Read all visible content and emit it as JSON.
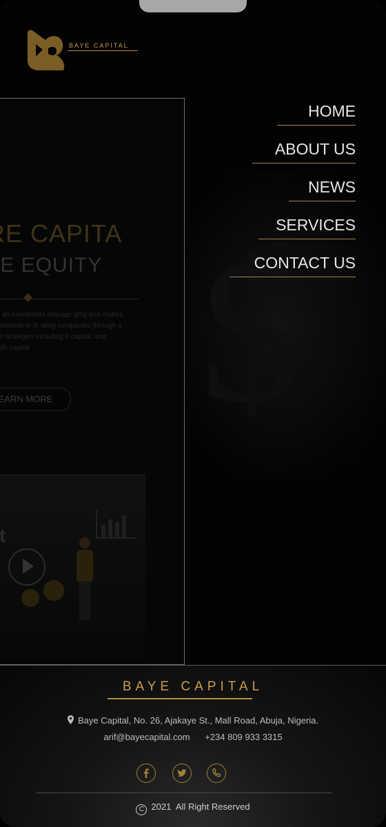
{
  "brand": {
    "logo_text": "BAYE CAPITAL",
    "accent_color": "#c49a4a"
  },
  "nav": {
    "items": [
      {
        "label": "HOME"
      },
      {
        "label": "ABOUT US"
      },
      {
        "label": "NEWS"
      },
      {
        "label": "SERVICES"
      },
      {
        "label": "CONTACT US"
      }
    ]
  },
  "preview": {
    "title_line1": "RE CAPITA",
    "title_line2": "TE EQUITY",
    "body": "firm, an investment manage ging and makes investments in th ating companies through a ment strategies including e capital, and growth capital",
    "button_label": "EARN MORE",
    "video_letter": "t",
    "play_icon": "play-icon"
  },
  "footer": {
    "brand": "BAYE CAPITAL",
    "address": "Baye Capital, No. 26, Ajakaye St., Mall Road, Abuja, Nigeria.",
    "email": "arif@bayecapital.com",
    "phone": "+234 809 933 3315",
    "social": [
      "facebook-icon",
      "twitter-icon",
      "phone-icon"
    ],
    "copyright_year": "2021",
    "copyright_text": "All Right Reserved"
  }
}
